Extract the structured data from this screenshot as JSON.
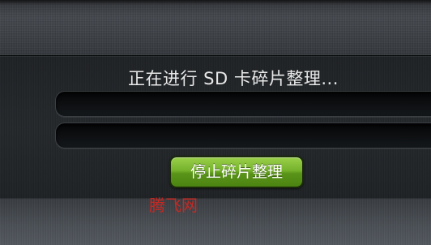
{
  "dialog": {
    "title": "正在进行 SD 卡碎片整理...",
    "progress_bars": [
      {
        "progress": 0
      },
      {
        "progress": 0
      }
    ],
    "stop_button_label": "停止碎片整理"
  },
  "watermark": {
    "text": "腾飞网"
  },
  "colors": {
    "button_green": "#6fae2a",
    "watermark_red": "#e0241c",
    "panel_dark": "#24282b"
  }
}
